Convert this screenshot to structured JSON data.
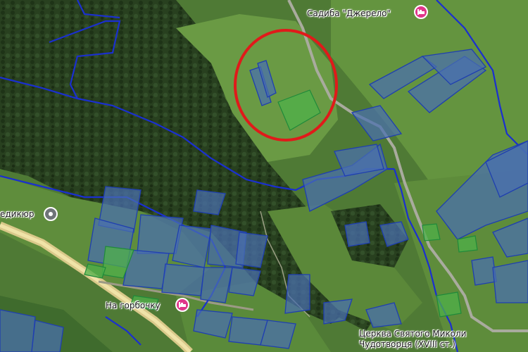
{
  "map": {
    "type": "satellite-cadastral",
    "colors": {
      "forest": "#28401f",
      "meadow": "#5c8a3c",
      "parcel_fill": "#4a6fb0",
      "parcel_stroke": "#1f3fb0",
      "boundary": "#1a2fd0",
      "highlight_circle": "#e01a1a",
      "road": "#d9c98a",
      "lodging_pin": "#e0368a",
      "poi_pin": "#6f7478"
    },
    "places": [
      {
        "name": "Садиба \"Джерело\"",
        "icon": "lodging-icon"
      },
      {
        "name": "едикюр",
        "icon": "poi-icon"
      },
      {
        "name": "На горбочку",
        "icon": "lodging-icon"
      },
      {
        "name": "Церква Святого Миколи",
        "icon": ""
      },
      {
        "name": "Чудотворця (XVIII ст.)",
        "icon": ""
      }
    ]
  }
}
